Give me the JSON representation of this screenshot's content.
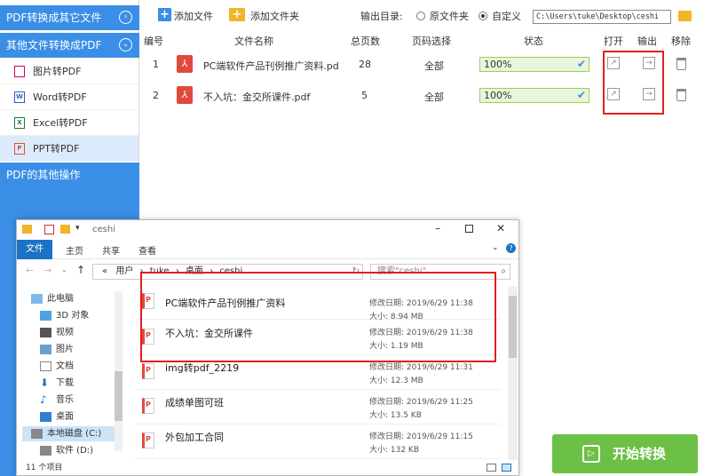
{
  "sidebar": {
    "cat1": "PDF转换成其它文件",
    "cat2": "其他文件转换成PDF",
    "items": [
      {
        "label": "图片转PDF",
        "icon": "image-icon"
      },
      {
        "label": "Word转PDF",
        "icon": "word-icon"
      },
      {
        "label": "Excel转PDF",
        "icon": "excel-icon"
      },
      {
        "label": "PPT转PDF",
        "icon": "ppt-icon"
      }
    ],
    "cat3": "PDF的其他操作"
  },
  "toolbar": {
    "add_file": "添加文件",
    "add_folder": "添加文件夹",
    "output_label": "输出目录:",
    "opt_original": "原文件夹",
    "opt_custom": "自定义",
    "output_path": "C:\\Users\\tuke\\Desktop\\ceshi"
  },
  "table": {
    "headers": [
      "编号",
      "文件名称",
      "总页数",
      "页码选择",
      "状态",
      "打开",
      "输出",
      "移除"
    ],
    "rows": [
      {
        "num": "1",
        "name": "PC端软件产品刊例推广资料.pd",
        "pages": "28",
        "range": "全部",
        "status": "100%"
      },
      {
        "num": "2",
        "name": "不入坑：金交所课件.pdf",
        "pages": "5",
        "range": "全部",
        "status": "100%"
      }
    ]
  },
  "explorer": {
    "title": "ceshi",
    "tabs": [
      "文件",
      "主页",
      "共享",
      "查看"
    ],
    "address": [
      "用户",
      "tuke",
      "桌面",
      "ceshi"
    ],
    "address_sep": "«",
    "search_placeholder": "搜索\"ceshi\"",
    "nav": [
      "此电脑",
      "3D 对象",
      "视频",
      "图片",
      "文档",
      "下载",
      "音乐",
      "桌面",
      "本地磁盘 (C:)",
      "软件 (D:)"
    ],
    "files": [
      {
        "name": "PC端软件产品刊例推广资料",
        "modified": "修改日期: 2019/6/29 11:38",
        "size": "大小: 8.94 MB"
      },
      {
        "name": "不入坑：金交所课件",
        "modified": "修改日期: 2019/6/29 11:38",
        "size": "大小: 1.19 MB"
      },
      {
        "name": "img转pdf_2219",
        "modified": "修改日期: 2019/6/29 11:31",
        "size": "大小: 12.3 MB"
      },
      {
        "name": "成绩单图可班",
        "modified": "修改日期: 2019/6/29 11:25",
        "size": "大小: 13.5 KB"
      },
      {
        "name": "外包加工合同",
        "modified": "修改日期: 2019/6/29 11:15",
        "size": "大小: 132 KB"
      }
    ],
    "status": "11 个项目"
  },
  "start_button": "开始转换",
  "colors": {
    "accent": "#3a8ee6",
    "highlight": "#e02020",
    "start": "#6cc046"
  }
}
